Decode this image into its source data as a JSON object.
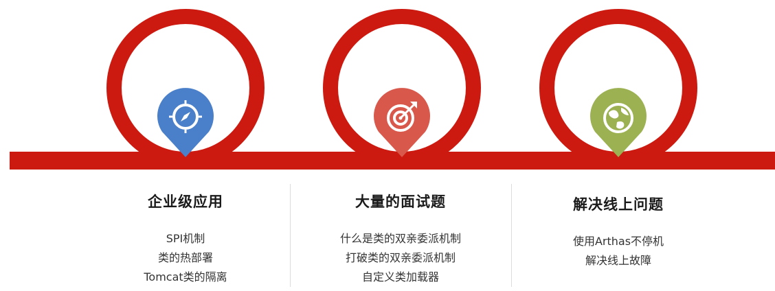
{
  "colors": {
    "track": "#cc1a10",
    "pin_blue": "#4a7fc9",
    "pin_red": "#d9584c",
    "pin_green": "#9bb152"
  },
  "stages": [
    {
      "icon": "compass-icon",
      "title": "企业级应用",
      "items": [
        "SPI机制",
        "类的热部署",
        "Tomcat类的隔离"
      ]
    },
    {
      "icon": "target-icon",
      "title": "大量的面试题",
      "items": [
        "什么是类的双亲委派机制",
        "打破类的双亲委派机制",
        "自定义类加载器"
      ]
    },
    {
      "icon": "globe-icon",
      "title": "解决线上问题",
      "items": [
        "使用Arthas不停机",
        "解决线上故障"
      ]
    }
  ]
}
